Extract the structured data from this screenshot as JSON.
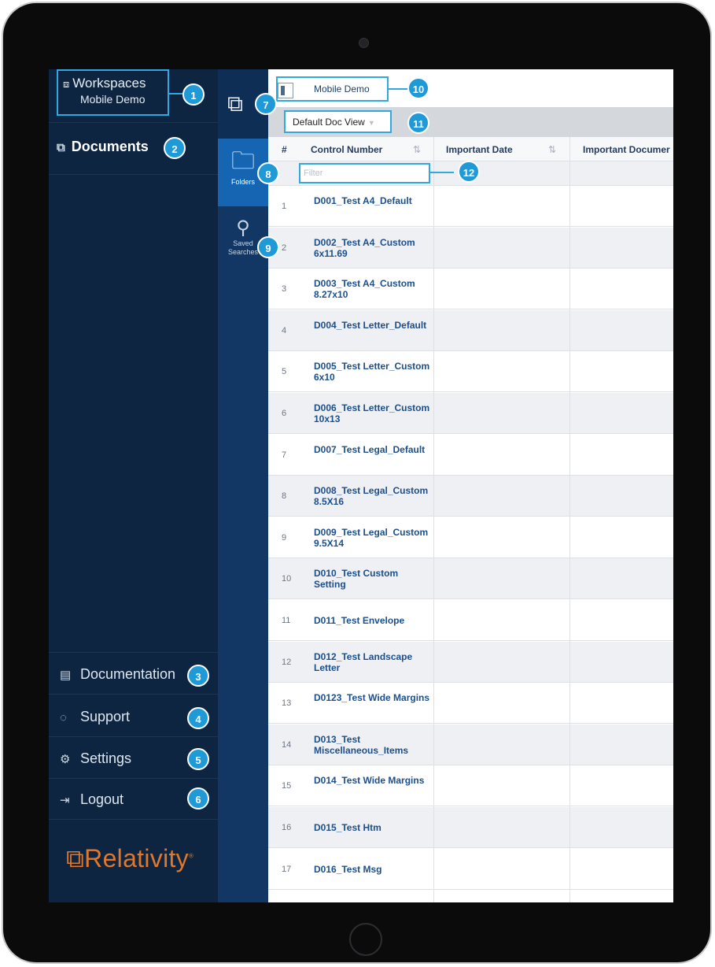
{
  "sidebar": {
    "workspaces_label": "Workspaces",
    "workspace_name": "Mobile Demo",
    "documents_label": "Documents",
    "bottom_items": [
      {
        "label": "Documentation",
        "icon": "document-icon"
      },
      {
        "label": "Support",
        "icon": "chat-icon"
      },
      {
        "label": "Settings",
        "icon": "gear-icon"
      },
      {
        "label": "Logout",
        "icon": "logout-icon"
      }
    ],
    "logo_text": "Relativity",
    "logo_mark": "⧉",
    "logo_tm": "®"
  },
  "rail": {
    "folders_label": "Folders",
    "saved_searches_label_1": "Saved",
    "saved_searches_label_2": "Searches"
  },
  "main": {
    "tab_label": "Mobile Demo",
    "view_label": "Default Doc View",
    "view_caret": "▼",
    "filter_placeholder": "Filter",
    "columns": {
      "num": "#",
      "control_number": "Control Number",
      "important_date": "Important Date",
      "important_document": "Important Documer",
      "sort_glyph": "⇅"
    },
    "rows": [
      {
        "num": "1",
        "name": "D001_Test A4_Default"
      },
      {
        "num": "2",
        "name": "D002_Test A4_Custom 6x11.69"
      },
      {
        "num": "3",
        "name": "D003_Test A4_Custom 8.27x10"
      },
      {
        "num": "4",
        "name": "D004_Test Letter_Default"
      },
      {
        "num": "5",
        "name": "D005_Test Letter_Custom 6x10"
      },
      {
        "num": "6",
        "name": "D006_Test Letter_Custom 10x13"
      },
      {
        "num": "7",
        "name": "D007_Test Legal_Default"
      },
      {
        "num": "8",
        "name": "D008_Test Legal_Custom 8.5X16"
      },
      {
        "num": "9",
        "name": "D009_Test Legal_Custom 9.5X14"
      },
      {
        "num": "10",
        "name": "D010_Test Custom Setting"
      },
      {
        "num": "11",
        "name": "D011_Test Envelope"
      },
      {
        "num": "12",
        "name": "D012_Test Landscape Letter"
      },
      {
        "num": "13",
        "name": "D0123_Test Wide Margins"
      },
      {
        "num": "14",
        "name": "D013_Test Miscellaneous_Items"
      },
      {
        "num": "15",
        "name": "D014_Test Wide Margins"
      },
      {
        "num": "16",
        "name": "D015_Test Htm"
      },
      {
        "num": "17",
        "name": "D016_Test Msg"
      }
    ]
  },
  "badges": [
    "1",
    "2",
    "3",
    "4",
    "5",
    "6",
    "7",
    "8",
    "9",
    "10",
    "11",
    "12"
  ],
  "colors": {
    "sidebar_bg": "#0d2541",
    "rail_bg": "#123765",
    "rail_active": "#1565b3",
    "accent": "#1f9ad6",
    "link_blue": "#1c4f8c",
    "logo_orange": "#e0772a"
  }
}
